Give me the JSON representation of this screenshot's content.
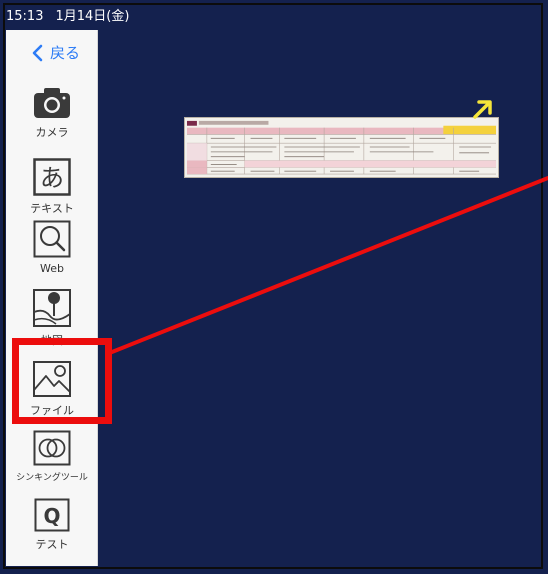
{
  "status_bar": {
    "time": "15:13",
    "date": "1月14日(金)"
  },
  "sidebar": {
    "back_label": "戻る",
    "tools": [
      {
        "label": "カメラ",
        "icon": "camera-icon"
      },
      {
        "label": "テキスト",
        "icon": "text-a-icon"
      },
      {
        "label": "Web",
        "icon": "magnifier-icon"
      },
      {
        "label": "地図",
        "icon": "map-pin-icon"
      },
      {
        "label": "ファイル",
        "icon": "image-file-icon"
      },
      {
        "label": "シンキングツール",
        "icon": "venn-circles-icon"
      },
      {
        "label": "テスト",
        "icon": "q-test-icon"
      }
    ]
  },
  "colors": {
    "background": "#14214e",
    "sidebar": "#f7f7f7",
    "accent": "#2d7cf6",
    "highlight": "#ec0d0d",
    "arrow": "#f5e53a"
  }
}
